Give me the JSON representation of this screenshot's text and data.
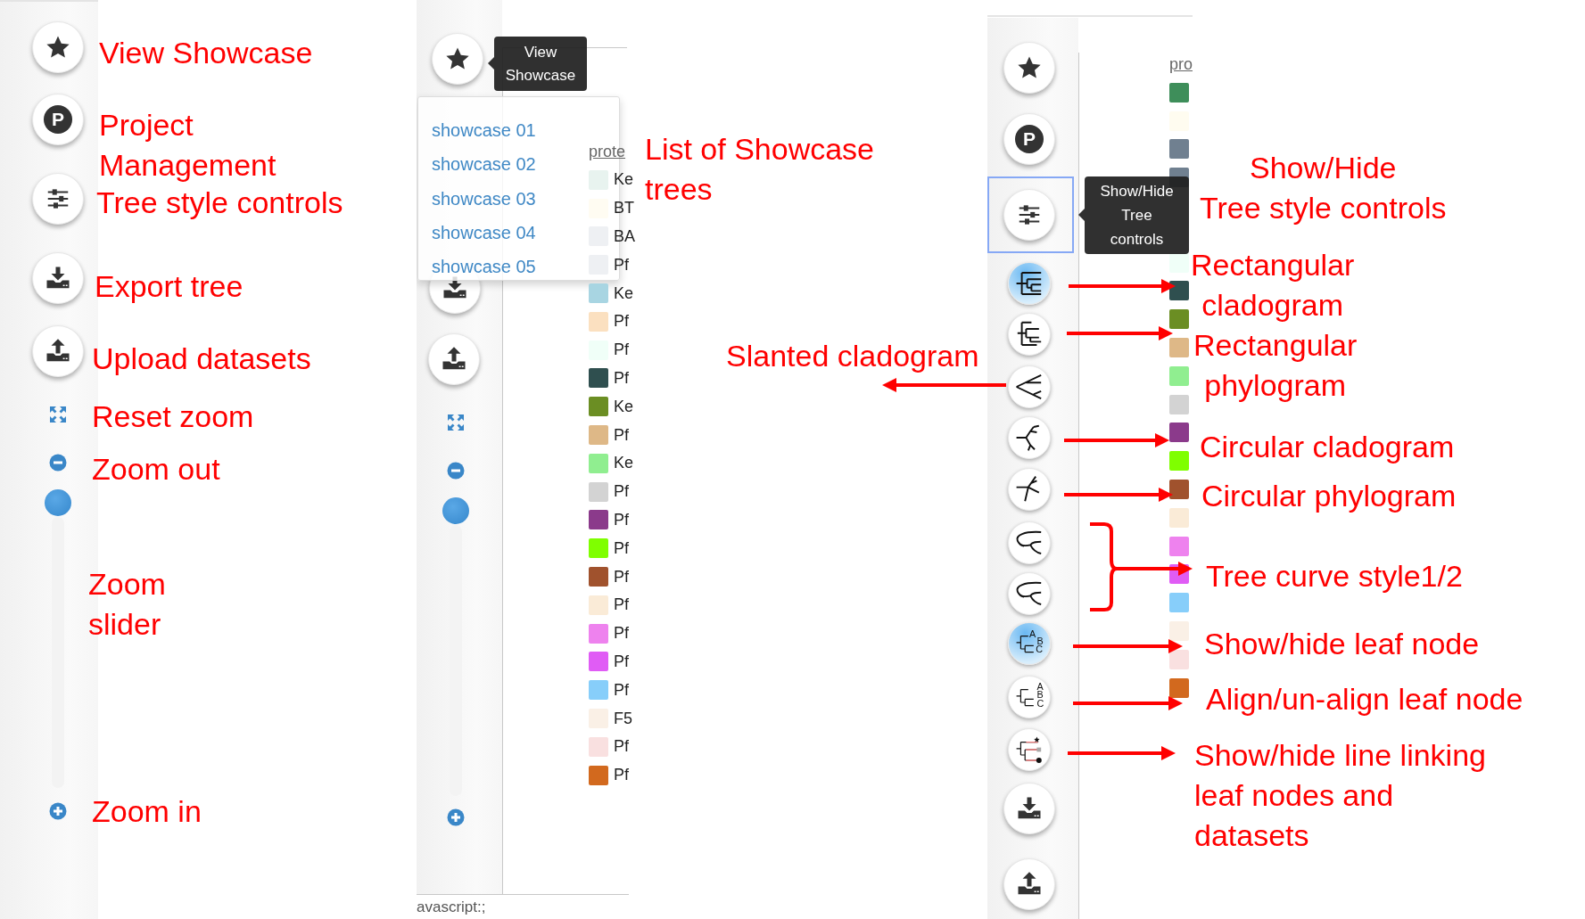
{
  "overview_panel": {
    "project_letter": "P",
    "annotations": [
      "View Showcase",
      "Project\nManagement",
      "Tree style controls",
      "Export tree",
      "Upload datasets",
      "Reset zoom",
      "Zoom out",
      "Zoom\nslider",
      "Zoom in"
    ]
  },
  "showcase_panel": {
    "tooltip": "View\nShowcase",
    "menu_items": [
      "showcase 01",
      "showcase 02",
      "showcase 03",
      "showcase 04",
      "showcase 05"
    ],
    "legend": {
      "header": "prote",
      "items": [
        {
          "label": "Ke",
          "color": "#e8f3ef"
        },
        {
          "label": "BT",
          "color": "#fffcf2"
        },
        {
          "label": "BA",
          "color": "#eef0f3"
        },
        {
          "label": "Pf",
          "color": "#eef0f3"
        },
        {
          "label": "Ke",
          "color": "#a8d5e2"
        },
        {
          "label": "Pf",
          "color": "#fbe0c0"
        },
        {
          "label": "Pf",
          "color": "#f0fff8"
        },
        {
          "label": "Pf",
          "color": "#2f4f4f"
        },
        {
          "label": "Ke",
          "color": "#6b8e23"
        },
        {
          "label": "Pf",
          "color": "#deb887"
        },
        {
          "label": "Ke",
          "color": "#90ee90"
        },
        {
          "label": "Pf",
          "color": "#d3d3d3"
        },
        {
          "label": "Pf",
          "color": "#8b3a8b"
        },
        {
          "label": "Pf",
          "color": "#7fff00"
        },
        {
          "label": "Pf",
          "color": "#a0522d"
        },
        {
          "label": "Pf",
          "color": "#faebd7"
        },
        {
          "label": "Pf",
          "color": "#ee82ee"
        },
        {
          "label": "Pf",
          "color": "#e05cf5"
        },
        {
          "label": "Pf",
          "color": "#87cefa"
        },
        {
          "label": "F5",
          "color": "#faf0e6"
        },
        {
          "label": "Pf",
          "color": "#f9e0e0"
        },
        {
          "label": "Pf",
          "color": "#d2691e"
        }
      ]
    },
    "annotation": "List of Showcase\ntrees",
    "status_bar": "avascript:;"
  },
  "controls_panel": {
    "project_letter": "P",
    "tooltip": "Show/Hide\nTree\ncontrols",
    "tree_buttons": [
      {
        "kind": "rect-cladogram",
        "active": true
      },
      {
        "kind": "rect-phylogram",
        "active": false
      },
      {
        "kind": "slanted",
        "active": false
      },
      {
        "kind": "circular-cladogram",
        "active": false
      },
      {
        "kind": "circular-phylogram",
        "active": false
      },
      {
        "kind": "curve",
        "active": false
      },
      {
        "kind": "curve",
        "active": false
      },
      {
        "kind": "leaf-node",
        "active": true,
        "letters": [
          "A",
          "B",
          "C"
        ]
      },
      {
        "kind": "align-leaf",
        "active": false,
        "letters": [
          "A",
          "B",
          "C"
        ]
      },
      {
        "kind": "link-line",
        "active": false
      }
    ],
    "legend": {
      "header": "pro",
      "items": [
        {
          "color": "#3e8e5a"
        },
        {
          "color": "#fffcf0"
        },
        {
          "color": "#708090"
        },
        {
          "color": "#708090"
        },
        {
          "color": "#f0fff8"
        },
        {
          "color": "#2f4f4f"
        },
        {
          "color": "#6b8e23"
        },
        {
          "color": "#deb887"
        },
        {
          "color": "#90ee90"
        },
        {
          "color": "#d3d3d3"
        },
        {
          "color": "#8b3a8b"
        },
        {
          "color": "#7fff00"
        },
        {
          "color": "#a0522d"
        },
        {
          "color": "#faebd7"
        },
        {
          "color": "#ee82ee"
        },
        {
          "color": "#e05cf5"
        },
        {
          "color": "#87cefa"
        },
        {
          "color": "#faf0e6"
        },
        {
          "color": "#f9e0e0"
        },
        {
          "color": "#d2691e"
        }
      ]
    },
    "annotations": [
      "Show/Hide\nTree style controls",
      "Rectangular\ncladogram",
      "Slanted cladogram",
      "Rectangular\nphylogram",
      "Circular cladogram",
      "Circular phylogram",
      "Tree curve style1/2",
      "Show/hide leaf node",
      "Align/un-align leaf node",
      "Show/hide line linking\nleaf nodes and\ndatasets"
    ]
  }
}
